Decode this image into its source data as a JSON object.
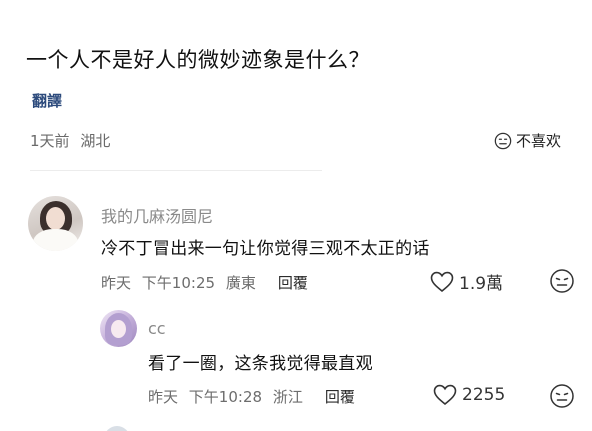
{
  "post": {
    "title": "一个人不是好人的微妙迹象是什么？",
    "translate_label": "翻譯",
    "time": "1天前",
    "location": "湖北",
    "dislike_label": "不喜欢"
  },
  "comments": [
    {
      "user": "我的几麻汤圆尼",
      "text": "冷不丁冒出来一句让你觉得三观不太正的话",
      "date": "昨天",
      "time": "下午10:25",
      "location": "廣東",
      "reply_label": "回覆",
      "likes": "1.9萬"
    },
    {
      "user": "cc",
      "text": "看了一圈，这条我觉得最直观",
      "date": "昨天",
      "time": "下午10:28",
      "location": "浙江",
      "reply_label": "回覆",
      "likes": "2255"
    }
  ],
  "icons": {
    "dislike": "neutral-face-icon",
    "like": "heart-outline-icon",
    "react": "neutral-face-icon"
  },
  "colors": {
    "translate_link": "#2c4a7c",
    "meta_text": "#6a6a6a",
    "username": "#8a8a8a"
  }
}
